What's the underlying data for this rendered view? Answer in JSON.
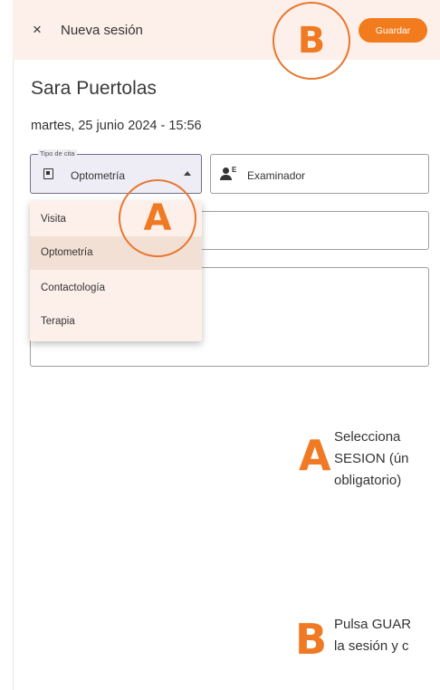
{
  "header": {
    "close_icon": "×",
    "title": "Nueva sesión",
    "save_label": "Guardar"
  },
  "patient": {
    "name": "Sara Puertolas",
    "date": "martes, 25 junio 2024 - 15:56"
  },
  "form": {
    "tipo_cita": {
      "legend": "Tipo de cita",
      "value": "Optometría",
      "icon": "calendar-square-icon"
    },
    "examinador": {
      "label": "Examinador",
      "icon": "person-tag-icon"
    }
  },
  "dropdown": {
    "options": [
      "Visita",
      "Optometría",
      "Contactología",
      "Terapia"
    ],
    "selected": "Optometría"
  },
  "markers": {
    "a": "A",
    "b": "B"
  },
  "instructions": {
    "a_lines": [
      "Selecciona",
      "SESION (ún",
      "obligatorio)"
    ],
    "b_lines": [
      "Pulsa GUAR",
      "la sesión y c"
    ]
  },
  "colors": {
    "accent": "#f27b1e",
    "header_bg": "#fdf0ea",
    "selected_bg": "#f3e0d4"
  }
}
